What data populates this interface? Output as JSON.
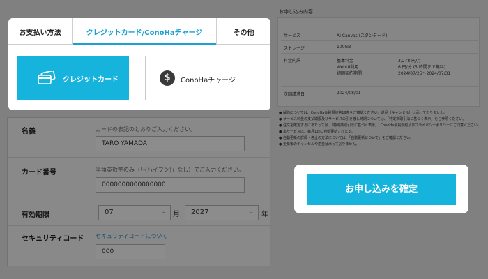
{
  "payment": {
    "tabs": [
      {
        "label": "お支払い方法"
      },
      {
        "label": "クレジットカード/ConoHaチャージ"
      },
      {
        "label": "その他"
      }
    ],
    "methods": [
      {
        "label": "クレジットカード",
        "icon": "credit-card-icon"
      },
      {
        "label": "ConoHaチャージ",
        "icon": "dollar-icon"
      }
    ]
  },
  "form": {
    "name": {
      "label": "名義",
      "desc": "カードの表記のとおりご入力ください。",
      "value": "TARO YAMADA"
    },
    "card_number": {
      "label": "カード番号",
      "desc": "半角英数字のみ（「-(ハイフン)」なし）でご入力ください。",
      "value": "0000000000000000"
    },
    "expiry": {
      "label": "有効期限",
      "month": "07",
      "month_unit": "月",
      "year": "2027",
      "year_unit": "年"
    },
    "security": {
      "label": "セキュリティコード",
      "link": "セキュリティコードについて",
      "value": "000"
    }
  },
  "summary": {
    "title": "お申し込み内容",
    "rows": [
      {
        "k": "サービス",
        "v1": "AI Canvas (スタンダード)",
        "v2": ""
      },
      {
        "k": "ストレージ",
        "v1": "100GB",
        "v2": ""
      },
      {
        "k": "料金内訳",
        "v1": "基本料金",
        "v2": "3,278 円/月"
      },
      {
        "k": "",
        "v1": "WebUI利用",
        "v2": "6 円/分 (5 時間まで無料)"
      },
      {
        "k": "",
        "v1": "初回契約期間",
        "v2": "2024/07/25〜2024/07/31"
      },
      {
        "k": "次回請求日",
        "v1": "2024/08/01",
        "v2": ""
      }
    ]
  },
  "notes": [
    "解約については、ConoHa会員規約第19条をご確認ください。返品（キャンセル）は承っておりません。",
    "サービス料金の支払期限及びサービスの引き渡し時期については、「特定商取引法に基づく表示」をご参照ください。",
    "注文を確定するにあたっては、「特定商取引法に基づく表示」、ConoHa会員規約及びプライバシーポリシーにご同意ください。",
    "本サービスは、毎月1日に自動更新されます。",
    "自動更新の詳細・停止の方法については、「自動更新について」をご確認ください。",
    "更新後のキャンセルや返金は承っておりません。"
  ],
  "confirm": {
    "label": "お申し込みを確定"
  }
}
